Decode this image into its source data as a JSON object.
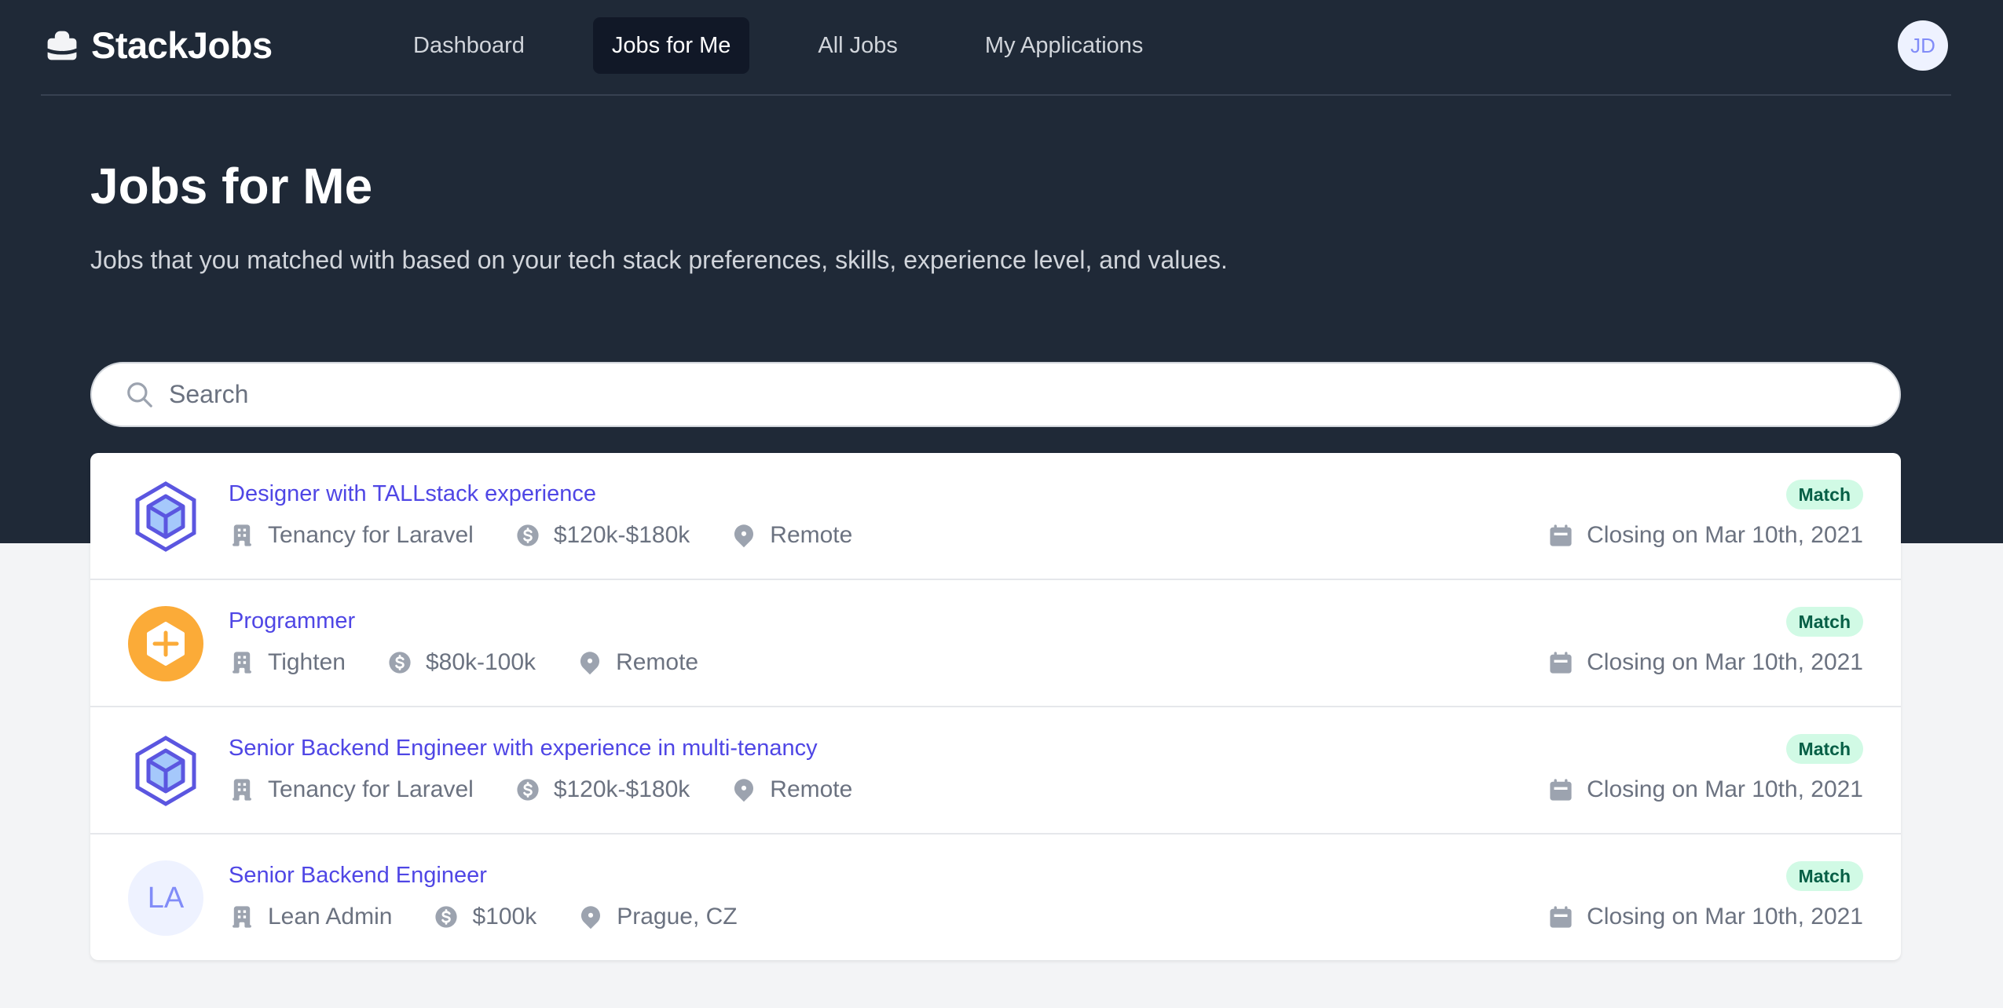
{
  "app": {
    "name": "StackJobs"
  },
  "nav": {
    "links": [
      {
        "label": "Dashboard",
        "active": false
      },
      {
        "label": "Jobs for Me",
        "active": true
      },
      {
        "label": "All Jobs",
        "active": false
      },
      {
        "label": "My Applications",
        "active": false
      }
    ],
    "avatar_initials": "JD"
  },
  "header": {
    "title": "Jobs for Me",
    "subtitle": "Jobs that you matched with based on your tech stack preferences, skills, experience level, and values."
  },
  "search": {
    "placeholder": "Search",
    "value": ""
  },
  "jobs": [
    {
      "title": "Designer with TALLstack experience",
      "company": "Tenancy for Laravel",
      "salary": "$120k-$180k",
      "location": "Remote",
      "badge": "Match",
      "closing": "Closing on Mar 10th, 2021",
      "logo": "tenancy-cube"
    },
    {
      "title": "Programmer",
      "company": "Tighten",
      "salary": "$80k-100k",
      "location": "Remote",
      "badge": "Match",
      "closing": "Closing on Mar 10th, 2021",
      "logo": "tighten"
    },
    {
      "title": "Senior Backend Engineer with experience in multi-tenancy",
      "company": "Tenancy for Laravel",
      "salary": "$120k-$180k",
      "location": "Remote",
      "badge": "Match",
      "closing": "Closing on Mar 10th, 2021",
      "logo": "tenancy-cube"
    },
    {
      "title": "Senior Backend Engineer",
      "company": "Lean Admin",
      "salary": "$100k",
      "location": "Prague, CZ",
      "badge": "Match",
      "closing": "Closing on Mar 10th, 2021",
      "logo": "initials",
      "initials": "LA"
    }
  ],
  "colors": {
    "accent": "#4f46e5",
    "header_bg": "#1f2937",
    "badge_bg": "#d1fae5",
    "badge_text": "#065f46",
    "tighten": "#fbab38"
  }
}
